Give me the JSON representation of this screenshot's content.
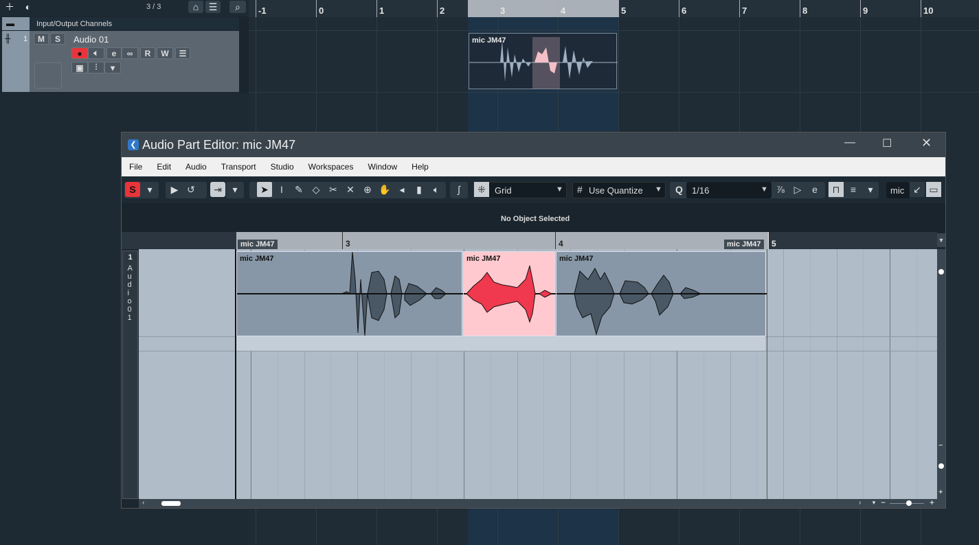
{
  "project": {
    "track_count": "3 / 3",
    "folder_label": "Input/Output Channels",
    "track": {
      "number": "1",
      "name": "Audio 01",
      "mute": "M",
      "solo": "S",
      "read": "R",
      "write": "W"
    },
    "ruler": [
      "-1",
      "0",
      "1",
      "2",
      "3",
      "4",
      "5",
      "6",
      "7",
      "8",
      "9",
      "10"
    ],
    "part_name": "mic JM47"
  },
  "editor": {
    "title": "Audio Part Editor: mic JM47",
    "menu": [
      "File",
      "Edit",
      "Audio",
      "Transport",
      "Studio",
      "Workspaces",
      "Window",
      "Help"
    ],
    "toolbar": {
      "snap_type": "Grid",
      "quantize_mode": "Use Quantize",
      "quantize_letter": "Q",
      "quantize_value": "1/16",
      "search_value": "mic"
    },
    "info_line": "No Object Selected",
    "ruler": [
      "3",
      "4",
      "5"
    ],
    "part_label": "mic JM47",
    "part_label_end": "mic JM47",
    "track_label": {
      "number": "1",
      "name": "Audio 01"
    },
    "events": [
      {
        "name": "mic JM47",
        "selected": false
      },
      {
        "name": "mic JM47",
        "selected": true
      },
      {
        "name": "mic JM47",
        "selected": false
      }
    ],
    "colors": {
      "selected_event": "#ffc9cf",
      "selected_wave": "#f0384e",
      "record": "#e8343a"
    }
  }
}
